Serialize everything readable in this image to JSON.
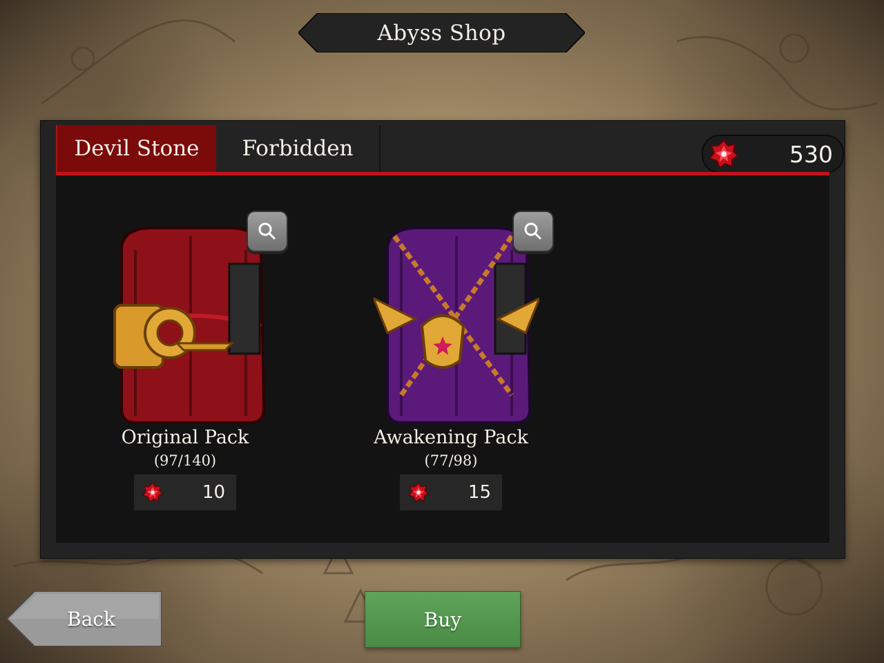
{
  "header": {
    "title": "Abyss Shop"
  },
  "tabs": [
    {
      "label": "Devil Stone",
      "active": true
    },
    {
      "label": "Forbidden",
      "active": false
    }
  ],
  "currency": {
    "icon": "devil-stone-icon",
    "amount": "530"
  },
  "packs": [
    {
      "name": "Original Pack",
      "count": "(97/140)",
      "price": "10",
      "price_icon": "devil-stone-icon",
      "color": "#8e1018"
    },
    {
      "name": "Awakening Pack",
      "count": "(77/98)",
      "price": "15",
      "price_icon": "devil-stone-icon",
      "color": "#5b1a7a"
    }
  ],
  "buttons": {
    "back": "Back",
    "buy": "Buy"
  },
  "colors": {
    "accent_red": "#c4121b",
    "tab_active": "#7b0a0a",
    "buy_green": "#5fa45a",
    "back_gray": "#9a9a9a"
  }
}
